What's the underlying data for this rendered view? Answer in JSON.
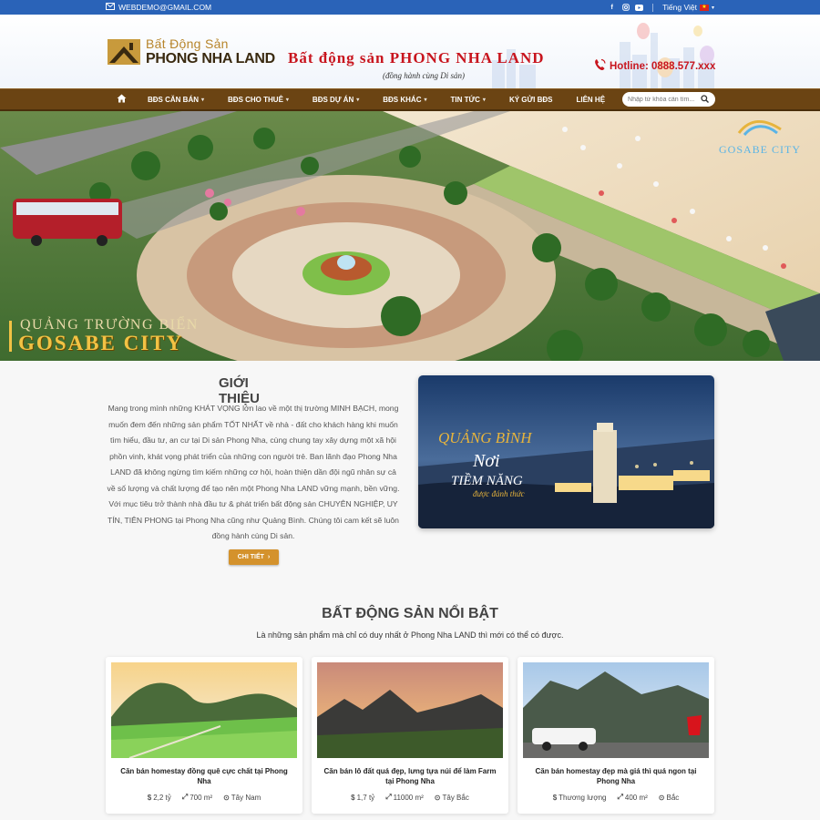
{
  "topbar": {
    "email": "WEBDEMO@GMAIL.COM",
    "language": "Tiếng Việt",
    "social": [
      "facebook-icon",
      "instagram-icon",
      "youtube-icon"
    ],
    "color": "#2a63b8"
  },
  "header": {
    "logo_line1": "Bất Động Sản",
    "logo_line2": "PHONG NHA LAND",
    "brand": "Bất động sản PHONG NHA LAND",
    "slogan": "(đồng hành cùng Di sản)",
    "hotline": "Hotline: 0888.577.xxx"
  },
  "nav": {
    "items": [
      {
        "label": "BĐS CĂN BÁN",
        "dropdown": true
      },
      {
        "label": "BĐS CHO THUÊ",
        "dropdown": true
      },
      {
        "label": "BĐS DỰ ÁN",
        "dropdown": true
      },
      {
        "label": "BĐS KHÁC",
        "dropdown": true
      },
      {
        "label": "TIN TỨC",
        "dropdown": true
      },
      {
        "label": "KÝ GỬI BĐS",
        "dropdown": false
      },
      {
        "label": "LIÊN HỆ",
        "dropdown": false
      }
    ],
    "search_placeholder": "Nhập từ khóa cần tìm...",
    "color": "#6b4413"
  },
  "hero": {
    "caption_line1": "QUẢNG TRƯỜNG BIỂN",
    "caption_line2": "GOSABE CITY",
    "badge": "GOSABE CITY"
  },
  "intro": {
    "title": "GIỚI THIỆU",
    "text": "Mang trong mình những KHÁT VỌNG lớn lao về một thị trường MINH BẠCH, mong muốn đem đến những sản phẩm TỐT NHẤT về nhà - đất cho khách hàng khi muốn tìm hiểu, đầu tư, an cư tại Di sản Phong Nha, cùng chung tay xây dựng một xã hội phồn vinh, khát vọng phát triển của những con người trẻ. Ban lãnh đạo Phong Nha LAND đã không ngừng tìm kiếm những cơ hội, hoàn thiện dần đội ngũ nhân sự cả về số lượng và chất lượng để tạo nên một Phong Nha LAND vững mạnh, bền vững. Với mục tiêu trở thành nhà đầu tư & phát triển bất động sản CHUYÊN NGHIỆP, UY TÍN, TIÊN PHONG tại Phong Nha cũng như Quảng Bình. Chúng tôi cam kết sẽ luôn đồng hành cùng Di sản.",
    "button": "CHI TIẾT",
    "image_text1": "QUẢNG BÌNH",
    "image_text2": "Nơi",
    "image_text3": "TIỀM NĂNG",
    "image_text4": "được đánh thức"
  },
  "featured": {
    "title": "BẤT ĐỘNG SẢN NỔI BẬT",
    "subtitle": "Là những sản phẩm mà chỉ có duy nhất ở Phong Nha LAND thì mới có thể có được.",
    "cards": [
      {
        "title": "Căn bán homestay đồng quê cực chất tại Phong Nha",
        "price": "2,2 tỷ",
        "area": "700 m²",
        "direction": "Tây Nam"
      },
      {
        "title": "Căn bán lô đất quá đẹp, lưng tựa núi để làm Farm tại Phong Nha",
        "price": "1,7 tỷ",
        "area": "11000 m²",
        "direction": "Tây Bắc"
      },
      {
        "title": "Căn bán homestay đẹp mà giá thì quá ngon tại Phong Nha",
        "price": "Thương lượng",
        "area": "400 m²",
        "direction": "Bắc"
      }
    ]
  }
}
